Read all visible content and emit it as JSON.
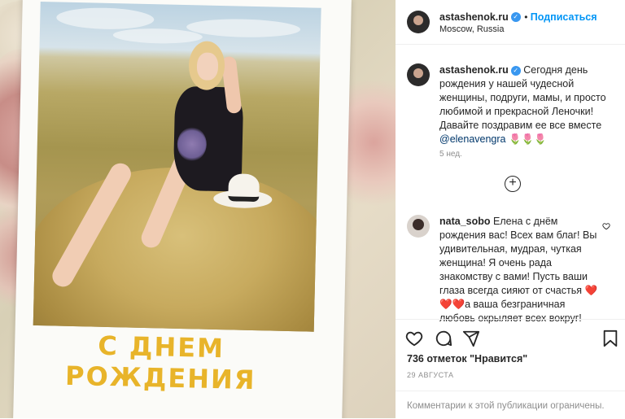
{
  "post": {
    "author": "astashenok.ru",
    "location": "Moscow, Russia",
    "follow_label": "Подписаться",
    "media_text": "С ДНЕМ РОЖДЕНИЯ"
  },
  "caption": {
    "username": "astashenok.ru",
    "text": "Сегодня день рождения у нашей чудесной женщины, подруги, мамы, и просто любимой и прекрасной Леночки! Давайте поздравим ее все вместе",
    "mention": "@elenavengra",
    "emoji": "🌷🌷🌷",
    "time": "5 нед."
  },
  "comment": {
    "username": "nata_sobo",
    "text": "Елена с днём рождения вас! Всех вам благ! Вы удивительная, мудрая, чуткая женщина! Я очень рада знакомству с вами! Пусть ваши глаза всегда сияют от счастья ❤️❤️❤️а ваша безграничная любовь окрыляет всех вокруг!"
  },
  "likes": "736 отметок \"Нравится\"",
  "date": "29 АВГУСТА",
  "comments_restricted": "Комментарии к этой публикации ограничены.",
  "icons": {
    "verified": "verified-badge-icon",
    "like": "heart-icon",
    "comment": "comment-icon",
    "share": "share-icon",
    "save": "bookmark-icon",
    "load_more": "plus-circle-icon",
    "comment_like": "small-heart-icon"
  },
  "colors": {
    "accent": "#0095f6",
    "verified": "#3897f0",
    "greeting_text": "#e8b42a"
  }
}
